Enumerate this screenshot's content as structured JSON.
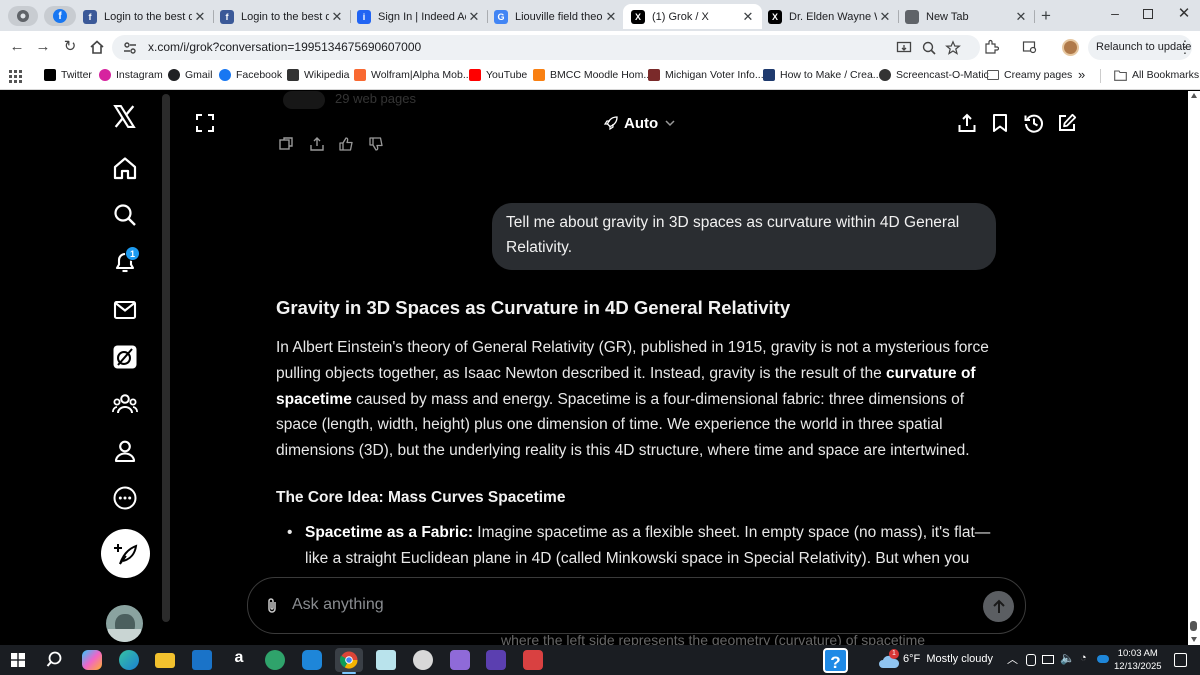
{
  "browser": {
    "tabs": [
      {
        "title": "",
        "favicon": "chrome-icon",
        "color": "#5f6368"
      },
      {
        "title": "",
        "favicon": "facebook-icon",
        "color": "#1877f2"
      },
      {
        "title": "Login to the best dat",
        "favicon": "facebook-icon",
        "color": "#3b5998"
      },
      {
        "title": "Login to the best dat",
        "favicon": "facebook-icon",
        "color": "#3b5998"
      },
      {
        "title": "Sign In | Indeed Acco",
        "favicon": "indeed-icon",
        "color": "#2164f3"
      },
      {
        "title": "Liouville field theory",
        "favicon": "google-icon",
        "color": "#4285f4"
      },
      {
        "title": "(1) Grok / X",
        "favicon": "x-icon",
        "color": "#000000"
      },
      {
        "title": "Dr. Elden Wayne Wh",
        "favicon": "x-icon",
        "color": "#000000"
      },
      {
        "title": "New Tab",
        "favicon": "chrome-icon",
        "color": "#5f6368"
      }
    ],
    "url": "x.com/i/grok?conversation=1995134675690607000",
    "relaunch_label": "Relaunch to update",
    "bookmarks": [
      {
        "label": "Twitter",
        "icon": "x-icon",
        "color": "#000000"
      },
      {
        "label": "Instagram",
        "icon": "instagram-icon",
        "color": "#d6249f"
      },
      {
        "label": "Gmail",
        "icon": "gmail-icon",
        "color": "#202124"
      },
      {
        "label": "Facebook",
        "icon": "facebook-icon",
        "color": "#1877f2"
      },
      {
        "label": "Wikipedia",
        "icon": "wikipedia-icon",
        "color": "#333333"
      },
      {
        "label": "Wolfram|Alpha Mob...",
        "icon": "wolfram-icon",
        "color": "#f96932"
      },
      {
        "label": "YouTube",
        "icon": "youtube-icon",
        "color": "#ff0000"
      },
      {
        "label": "BMCC Moodle Hom...",
        "icon": "moodle-icon",
        "color": "#f98012"
      },
      {
        "label": "Michigan Voter Info...",
        "icon": "flag-icon",
        "color": "#7a2a2a"
      },
      {
        "label": "How to Make / Crea...",
        "icon": "tutorial-icon",
        "color": "#1f3a6e"
      },
      {
        "label": "Screencast-O-Matic",
        "icon": "screencast-icon",
        "color": "#333333"
      },
      {
        "label": "Creamy pages",
        "icon": "folder-icon",
        "color": "#5f6368"
      }
    ],
    "all_bookmarks_label": "All Bookmarks"
  },
  "x": {
    "notification_count": "1",
    "mode_label": "Auto",
    "faded_sources": "29 web pages",
    "user_message": "Tell me about gravity in 3D spaces as curvature within 4D General Relativity.",
    "response": {
      "title": "Gravity in 3D Spaces as Curvature in 4D General Relativity",
      "para_1": "In Albert Einstein's theory of General Relativity (GR), published in 1915, gravity is not a mysterious force pulling objects together, as Isaac Newton described it. Instead, gravity is the result of the ",
      "para_bold": "curvature of spacetime",
      "para_2": " caused by mass and energy. Spacetime is a four-dimensional fabric: three dimensions of space (length, width, height) plus one dimension of time. We experience the world in three spatial dimensions (3D), but the underlying reality is this 4D structure, where time and space are intertwined.",
      "subheading": "The Core Idea: Mass Curves Spacetime",
      "bullet_bold": "Spacetime as a Fabric:",
      "bullet_text": " Imagine spacetime as a flexible sheet. In empty space (no mass), it's flat—like a straight Euclidean plane in 4D (called Minkowski space in Special Relativity). But when you place",
      "cutoff_text": "where the left side represents the geometry (curvature) of spacetime"
    },
    "composer_placeholder": "Ask anything"
  },
  "taskbar": {
    "weather_temp": "6°F",
    "weather_desc": "Mostly cloudy",
    "time": "10:03 AM",
    "date": "12/13/2025",
    "weather_badge": "1"
  }
}
